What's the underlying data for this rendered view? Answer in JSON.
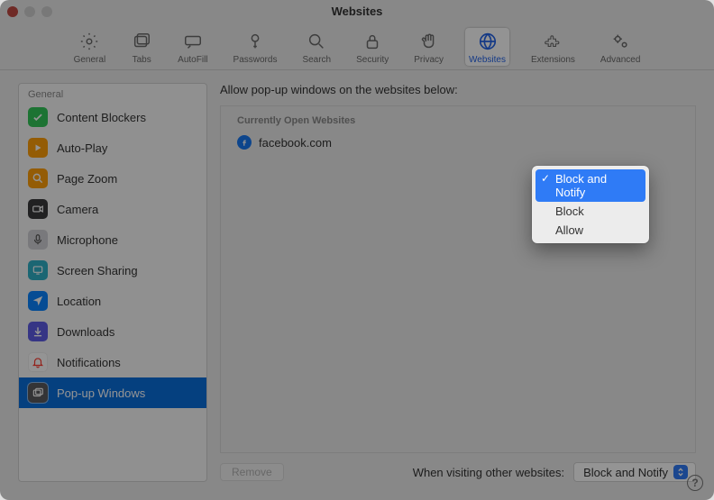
{
  "window": {
    "title": "Websites"
  },
  "toolbar": {
    "items": [
      {
        "label": "General"
      },
      {
        "label": "Tabs"
      },
      {
        "label": "AutoFill"
      },
      {
        "label": "Passwords"
      },
      {
        "label": "Search"
      },
      {
        "label": "Security"
      },
      {
        "label": "Privacy"
      },
      {
        "label": "Websites"
      },
      {
        "label": "Extensions"
      },
      {
        "label": "Advanced"
      }
    ]
  },
  "sidebar": {
    "section": "General",
    "items": [
      {
        "label": "Content Blockers"
      },
      {
        "label": "Auto-Play"
      },
      {
        "label": "Page Zoom"
      },
      {
        "label": "Camera"
      },
      {
        "label": "Microphone"
      },
      {
        "label": "Screen Sharing"
      },
      {
        "label": "Location"
      },
      {
        "label": "Downloads"
      },
      {
        "label": "Notifications"
      },
      {
        "label": "Pop-up Windows"
      }
    ]
  },
  "main": {
    "prompt": "Allow pop-up windows on the websites below:",
    "list_header": "Currently Open Websites",
    "websites": [
      {
        "domain": "facebook.com"
      }
    ],
    "remove_label": "Remove",
    "footer_label": "When visiting other websites:",
    "footer_value": "Block and Notify"
  },
  "popup": {
    "options": [
      {
        "label": "Block and Notify",
        "selected": true
      },
      {
        "label": "Block",
        "selected": false
      },
      {
        "label": "Allow",
        "selected": false
      }
    ]
  },
  "help": "?"
}
